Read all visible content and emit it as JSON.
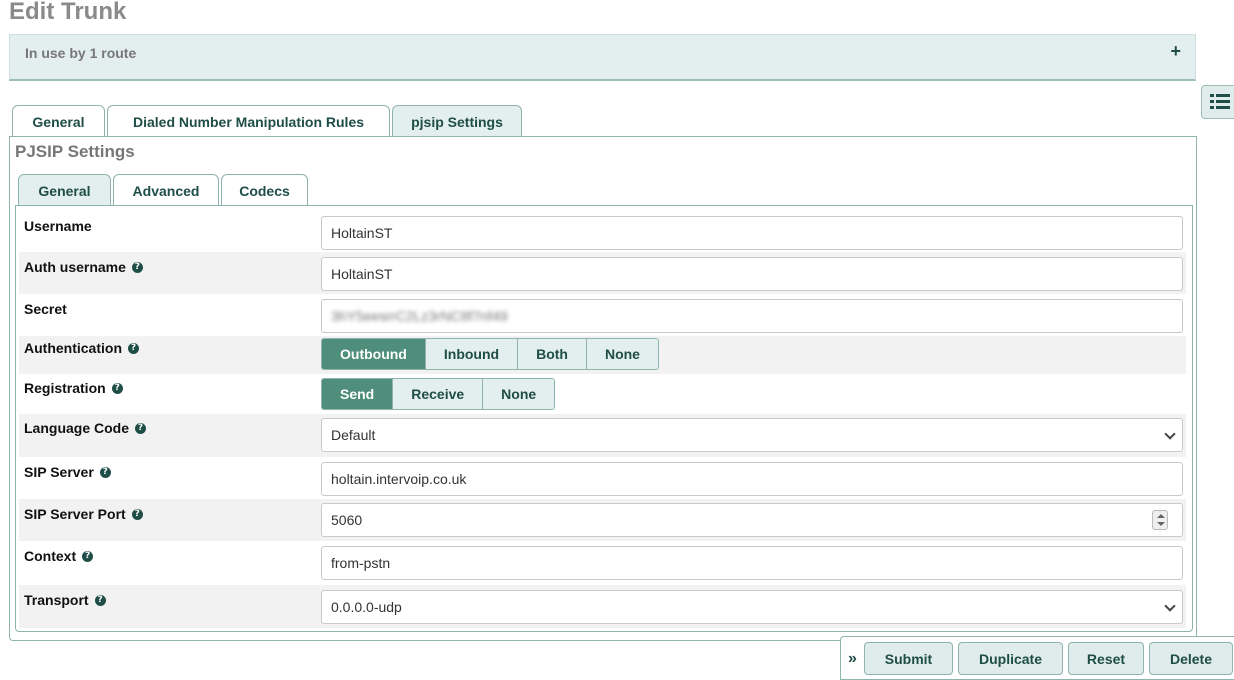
{
  "page": {
    "title": "Edit Trunk",
    "route_banner": "In use by 1 route",
    "plus_symbol": "+"
  },
  "outer_tabs": [
    {
      "label": "General"
    },
    {
      "label": "Dialed Number Manipulation Rules"
    },
    {
      "label": "pjsip Settings"
    }
  ],
  "section_title": "PJSIP Settings",
  "inner_tabs": [
    {
      "label": "General"
    },
    {
      "label": "Advanced"
    },
    {
      "label": "Codecs"
    }
  ],
  "form": {
    "username": {
      "label": "Username",
      "value": "HoltainST"
    },
    "auth_username": {
      "label": "Auth username",
      "value": "HoltainST"
    },
    "secret": {
      "label": "Secret",
      "value": "3hY5eesrrC2Lz3rNC8f7nf49"
    },
    "authentication": {
      "label": "Authentication",
      "options": [
        "Outbound",
        "Inbound",
        "Both",
        "None"
      ],
      "selected": "Outbound"
    },
    "registration": {
      "label": "Registration",
      "options": [
        "Send",
        "Receive",
        "None"
      ],
      "selected": "Send"
    },
    "language_code": {
      "label": "Language Code",
      "value": "Default"
    },
    "sip_server": {
      "label": "SIP Server",
      "value": "holtain.intervoip.co.uk"
    },
    "sip_server_port": {
      "label": "SIP Server Port",
      "value": "5060"
    },
    "context": {
      "label": "Context",
      "value": "from-pstn"
    },
    "transport": {
      "label": "Transport",
      "value": "0.0.0.0-udp"
    }
  },
  "actions": {
    "collapse_symbol": "»",
    "submit": "Submit",
    "duplicate": "Duplicate",
    "reset": "Reset",
    "delete": "Delete"
  },
  "colors": {
    "accent": "#4e8e7a",
    "accent_dark": "#1f4d47",
    "panel_bg": "#e3efee",
    "border": "#8fb3ad"
  },
  "icons": {
    "help": "help-icon",
    "list": "list-icon",
    "expand": "plus-icon",
    "dropdown": "chevron-down-icon",
    "spinner": "spinner-icon",
    "collapse": "double-chevron-right-icon"
  }
}
